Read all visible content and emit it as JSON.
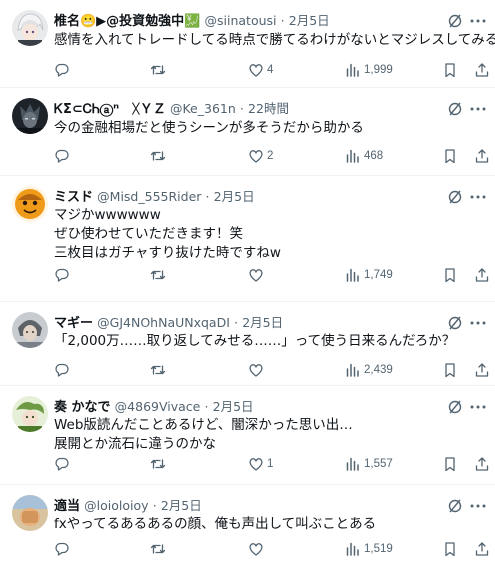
{
  "tweets": [
    {
      "name": "椎名😬▶@投資勉強中💹",
      "handle": "@siinatousi",
      "date": "2月5日",
      "lines": [
        "感情を入れてトレードしてる時点で勝てるわけがないとマジレスしてみる😇"
      ],
      "likes": "4",
      "views": "1,999",
      "avatar_color": "#d6d9dc",
      "avatar_icon": "silver-hair-character-avatar"
    },
    {
      "name": "ᏦƩ⊂ᏟᏂⓐⁿ　ᚷＹＺ",
      "handle": "@Ke_361n",
      "date": "22時間",
      "lines": [
        "今の金融相場だと使うシーンが多そうだから助かる"
      ],
      "likes": "2",
      "views": "468",
      "avatar_color": "#2b3036",
      "avatar_icon": "dark-character-avatar"
    },
    {
      "name": "ミスド",
      "handle": "@Misd_555Rider",
      "date": "2月5日",
      "lines": [
        "マジかwwwwww",
        "ぜひ使わせていただきます！笑",
        "三枚目はガチャすり抜けた時ですねw"
      ],
      "likes": "",
      "views": "1,749",
      "avatar_color": "#e8961e",
      "avatar_icon": "orange-character-avatar"
    },
    {
      "name": "マギー",
      "handle": "@GJ4NOhNaUNxqaDI",
      "date": "2月5日",
      "lines": [
        "「2,000万……取り返してみせる……」って使う日来るんだろか？"
      ],
      "likes": "",
      "views": "2,439",
      "avatar_color": "#9aa0a6",
      "avatar_icon": "gray-character-avatar"
    },
    {
      "name": "奏 かなで",
      "handle": "@4869Vivace",
      "date": "2月5日",
      "lines": [
        "Web版読んだことあるけど、闇深かった思い出…",
        "展開とか流石に違うのかな"
      ],
      "likes": "1",
      "views": "1,557",
      "avatar_color": "#8fb36a",
      "avatar_icon": "green-character-avatar"
    },
    {
      "name": "適当",
      "handle": "@loioloioy",
      "date": "2月5日",
      "lines": [
        "fxやってるあるあるの顔、俺も声出して叫ぶことある"
      ],
      "likes": "",
      "views": "1,519",
      "avatar_color": "#c9a46a",
      "avatar_icon": "blurred-photo-avatar"
    }
  ],
  "colors": {
    "text": "#0f1419",
    "muted": "#536471",
    "divider": "#eff3f4"
  }
}
